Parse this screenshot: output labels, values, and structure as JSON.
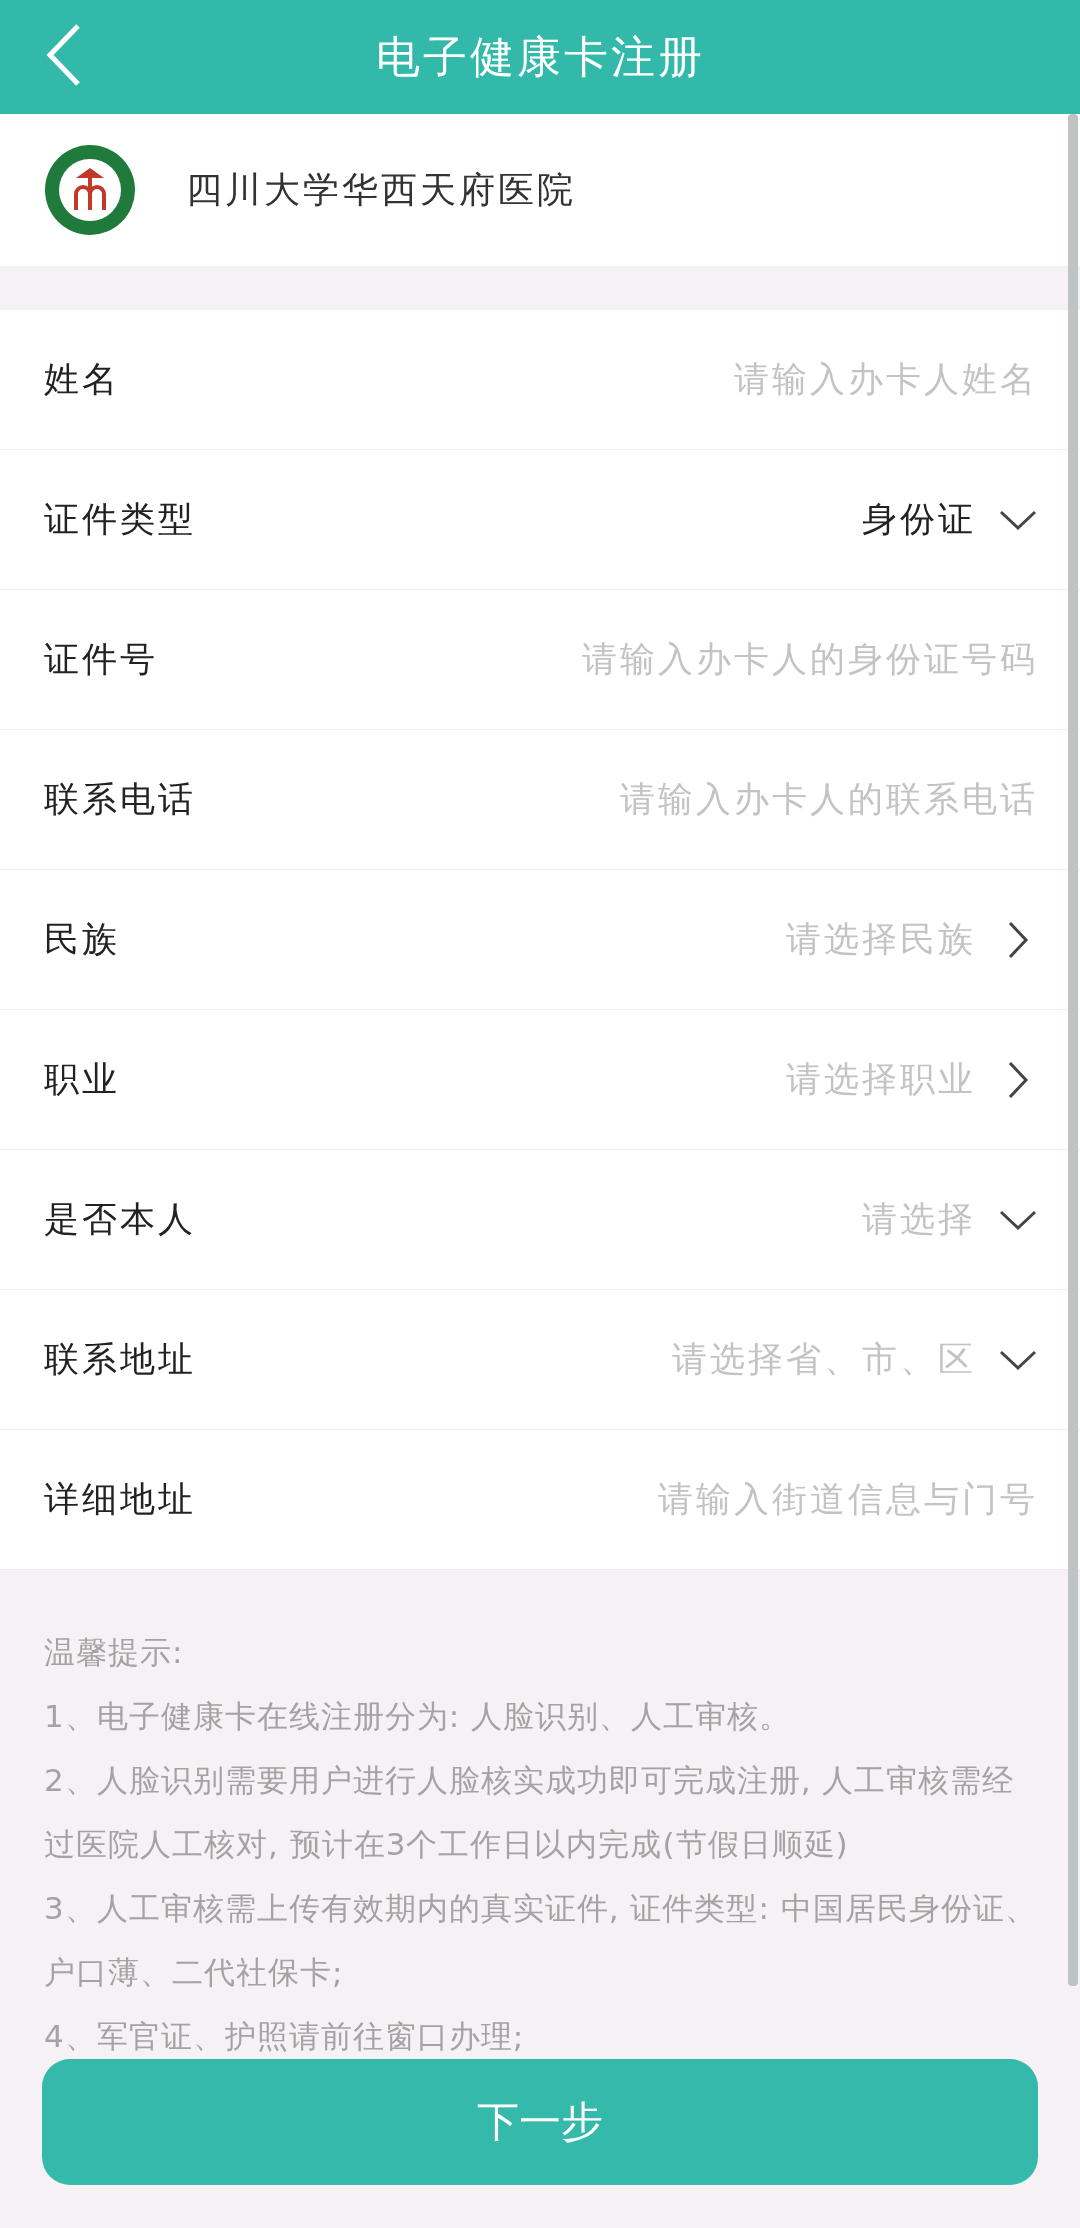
{
  "header": {
    "title": "电子健康卡注册"
  },
  "hospital": {
    "name": "四川大学华西天府医院"
  },
  "form": [
    {
      "label": "姓名",
      "kind": "input",
      "placeholder": "请输入办卡人姓名"
    },
    {
      "label": "证件类型",
      "kind": "select-down",
      "value": "身份证"
    },
    {
      "label": "证件号",
      "kind": "input",
      "placeholder": "请输入办卡人的身份证号码"
    },
    {
      "label": "联系电话",
      "kind": "input",
      "placeholder": "请输入办卡人的联系电话"
    },
    {
      "label": "民族",
      "kind": "select-right",
      "placeholder": "请选择民族"
    },
    {
      "label": "职业",
      "kind": "select-right",
      "placeholder": "请选择职业"
    },
    {
      "label": "是否本人",
      "kind": "select-down",
      "placeholder": "请选择"
    },
    {
      "label": "联系地址",
      "kind": "select-down",
      "placeholder": "请选择省、市、区"
    },
    {
      "label": "详细地址",
      "kind": "input",
      "placeholder": "请输入街道信息与门号"
    }
  ],
  "tips": {
    "title": "温馨提示:",
    "items": [
      "1、电子健康卡在线注册分为: 人脸识别、人工审核。",
      "2、人脸识别需要用户进行人脸核实成功即可完成注册, 人工审核需经过医院人工核对, 预计在3个工作日以内完成(节假日顺延)",
      "3、人工审核需上传有效期内的真实证件, 证件类型: 中国居民身份证、户口薄、二代社保卡;",
      "4、军官证、护照请前往窗口办理;"
    ]
  },
  "next_button": "下一步"
}
